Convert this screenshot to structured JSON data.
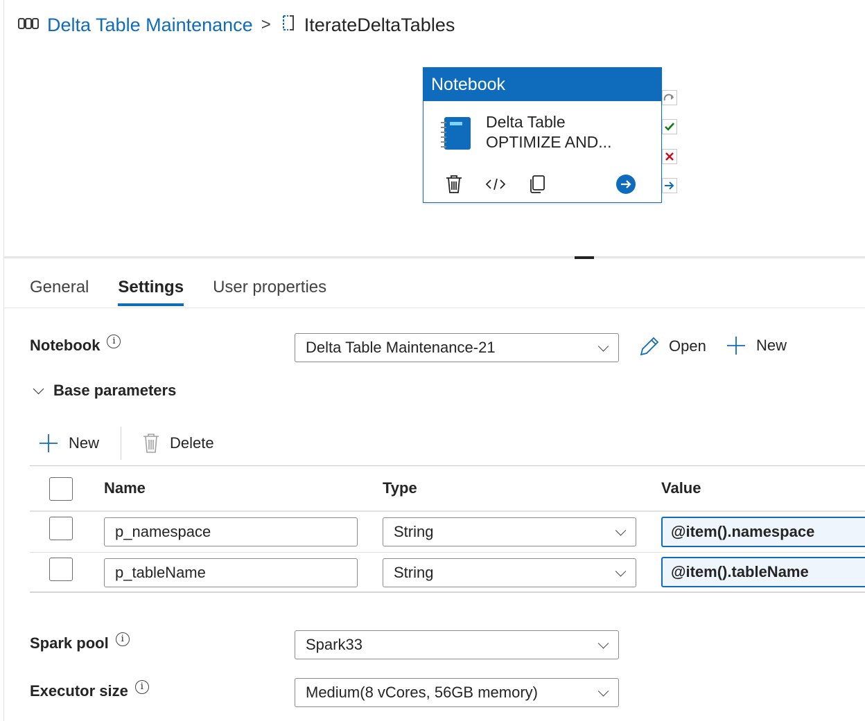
{
  "breadcrumb": {
    "pipeline": "Delta Table Maintenance",
    "separator": ">",
    "current": "IterateDeltaTables"
  },
  "activity": {
    "type_label": "Notebook",
    "name": "Delta Table\nOPTIMIZE AND...",
    "header_color": "#0f6cbd"
  },
  "tabs": [
    {
      "label": "General"
    },
    {
      "label": "Settings"
    },
    {
      "label": "User properties"
    }
  ],
  "settings": {
    "notebook_label": "Notebook",
    "notebook_value": "Delta Table Maintenance-21",
    "open_label": "Open",
    "new_label": "New",
    "base_params_label": "Base parameters",
    "toolbar_new": "New",
    "toolbar_delete": "Delete",
    "columns": {
      "name": "Name",
      "type": "Type",
      "value": "Value"
    },
    "params": [
      {
        "name": "p_namespace",
        "type": "String",
        "value": "@item().namespace"
      },
      {
        "name": "p_tableName",
        "type": "String",
        "value": "@item().tableName"
      }
    ],
    "spark_pool_label": "Spark pool",
    "spark_pool_value": "Spark33",
    "executor_size_label": "Executor size",
    "executor_size_value": "Medium(8 vCores, 56GB memory)"
  }
}
